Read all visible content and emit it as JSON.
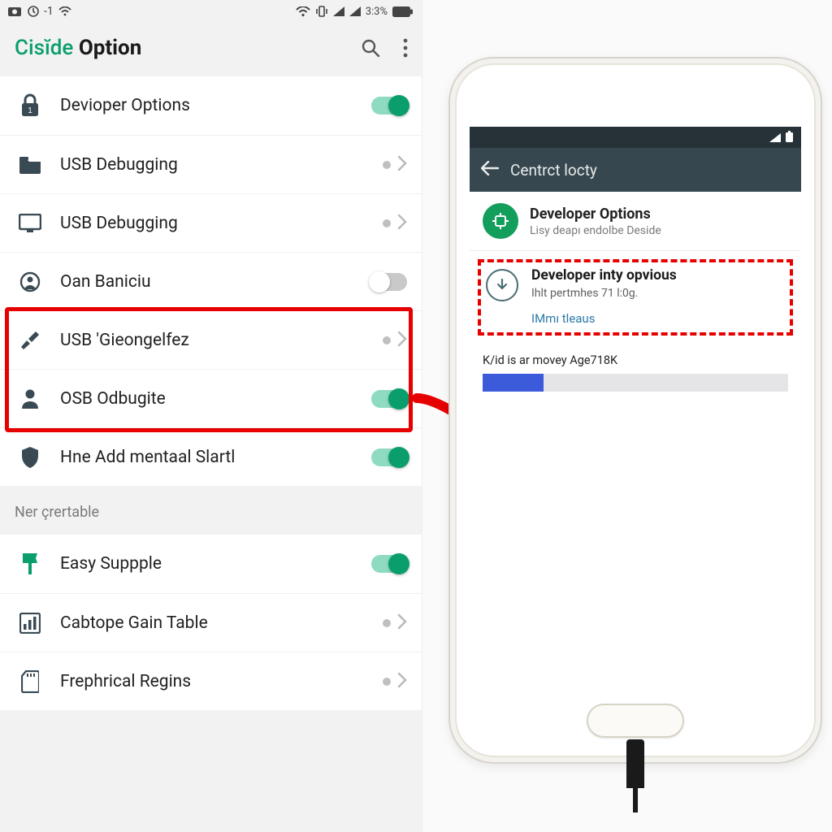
{
  "status": {
    "carrier_label": "-1",
    "battery_pct": "3:3%"
  },
  "appbar": {
    "title_accent": "Cisĭde",
    "title_bold": "Option"
  },
  "list": {
    "items": [
      {
        "icon": "lock-icon",
        "label": "Devioper Options",
        "control": "toggle-on"
      },
      {
        "icon": "folder-icon",
        "label": "USB Debugging",
        "control": "dot-chevron"
      },
      {
        "icon": "monitor-icon",
        "label": "USB Debugging",
        "control": "dot-chevron"
      },
      {
        "icon": "person-q-icon",
        "label": "Oan Baniciu",
        "control": "toggle-off"
      },
      {
        "icon": "wrench-icon",
        "label": "USB 'Gieongelfez",
        "control": "dot-chevron"
      },
      {
        "icon": "person-icon",
        "label": "OSB Odbugite",
        "control": "toggle-on"
      },
      {
        "icon": "shield-icon",
        "label": "Hne Add mentaal Slartl",
        "control": "toggle-on"
      }
    ],
    "section_header": "Ner çrertable",
    "items2": [
      {
        "icon": "badge-icon",
        "label": "Easy Suppple",
        "control": "toggle-on"
      },
      {
        "icon": "bars-icon",
        "label": "Cabtope Gain Table",
        "control": "dot-chevron"
      },
      {
        "icon": "sdcard-icon",
        "label": "Frephrical Regins",
        "control": "dot-chevron"
      }
    ]
  },
  "highlight": {
    "row_start": 4,
    "row_end": 5
  },
  "phone": {
    "appbar_title": "Centrct locty",
    "card1": {
      "title": "Developer Options",
      "subtitle": "Lisy deapı endolbe Deside"
    },
    "card2": {
      "title": "Developer inty opvious",
      "subtitle": "Ihlt pertmhes 71 l:0g.",
      "link": "IMmı tleaus"
    },
    "progress": {
      "label": "K/id is ar movey Age718K",
      "percent": 20
    }
  }
}
